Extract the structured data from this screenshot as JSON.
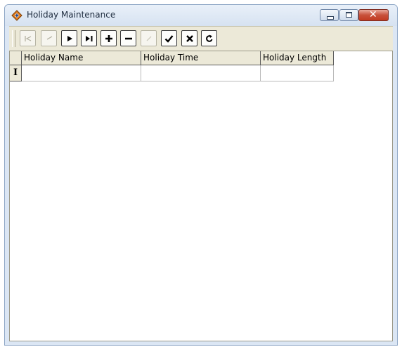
{
  "window": {
    "title": "Holiday Maintenance",
    "close_color": "#c23b22"
  },
  "navigator": {
    "buttons": [
      {
        "name": "first",
        "icon": "first-record-icon",
        "enabled": false
      },
      {
        "name": "prior",
        "icon": "prior-record-icon",
        "enabled": false
      },
      {
        "name": "next",
        "icon": "next-record-icon",
        "enabled": true
      },
      {
        "name": "last",
        "icon": "last-record-icon",
        "enabled": true
      },
      {
        "name": "insert",
        "icon": "plus-icon",
        "enabled": true
      },
      {
        "name": "delete",
        "icon": "minus-icon",
        "enabled": true
      },
      {
        "name": "edit",
        "icon": "edit-icon",
        "enabled": false
      },
      {
        "name": "post",
        "icon": "checkmark-icon",
        "enabled": true
      },
      {
        "name": "cancel",
        "icon": "x-icon",
        "enabled": true
      },
      {
        "name": "refresh",
        "icon": "refresh-icon",
        "enabled": true
      }
    ]
  },
  "grid": {
    "columns": [
      "Holiday Name",
      "Holiday Time",
      "Holiday Length"
    ],
    "current_row_indicator": "I",
    "rows": [
      [
        "",
        "",
        ""
      ]
    ]
  }
}
